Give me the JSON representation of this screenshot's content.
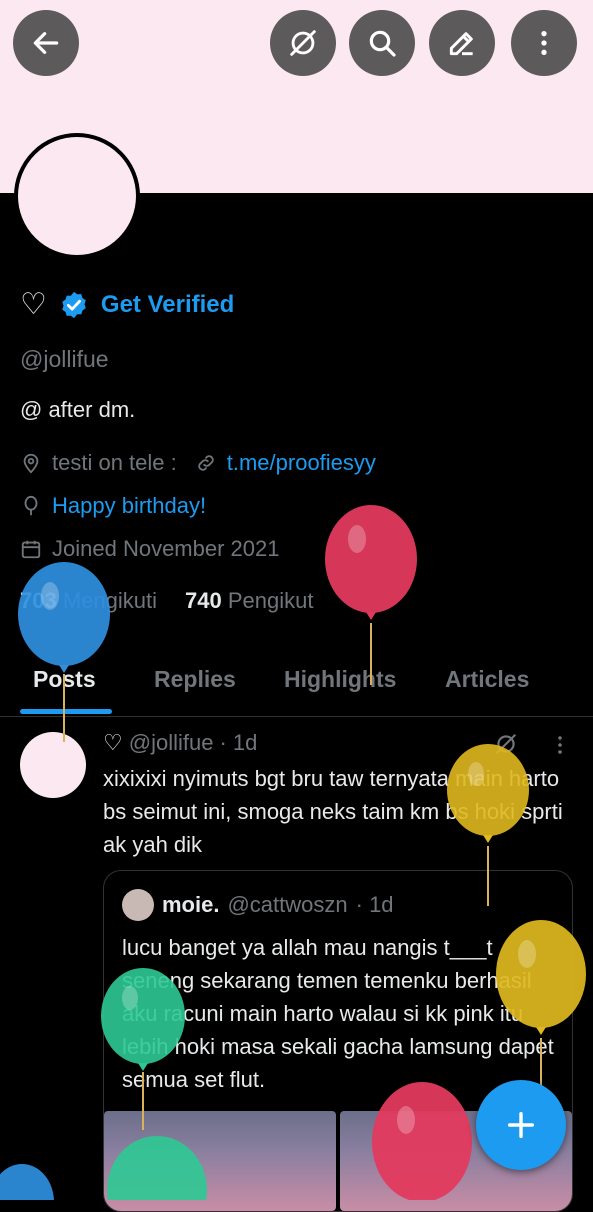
{
  "header": {
    "buttons": [
      "back",
      "grok",
      "search",
      "edit",
      "more"
    ]
  },
  "profile": {
    "name_symbol": "♡",
    "verified_label": "Get Verified",
    "handle": "@jollifue",
    "bio": "@ after dm.",
    "location": "testi on tele :",
    "website": "t.me/proofiesyy",
    "birthday": "Happy birthday!",
    "joined": "Joined November 2021",
    "following_count": "703",
    "following_label": "Mengikuti",
    "followers_count": "740",
    "followers_label": "Pengikut"
  },
  "tabs": [
    "Posts",
    "Replies",
    "Highlights",
    "Articles"
  ],
  "post": {
    "name_symbol": "♡",
    "handle": "@jollifue",
    "time": "· 1d",
    "text": "xixixixi nyimuts bgt bru taw ternyata main harto bs seimut ini, smoga neks taim km bs hoki sprti ak yah dik",
    "quote": {
      "name": "moie.",
      "handle": "@cattwoszn",
      "time": "· 1d",
      "text": "lucu banget ya allah mau nangis t___t seneng sekarang temen temenku berhasil aku racuni main harto walau si kk pink itu lebih hoki masa sekali gacha lamsung dapet semua set flut."
    }
  },
  "colors": {
    "accent": "#1d9bf0",
    "banner": "#fce8f0",
    "background": "#000000",
    "balloon_blue": "#2f8fe0",
    "balloon_red": "#e23a5e",
    "balloon_yellow": "#e0b81f",
    "balloon_green": "#2dc993"
  }
}
